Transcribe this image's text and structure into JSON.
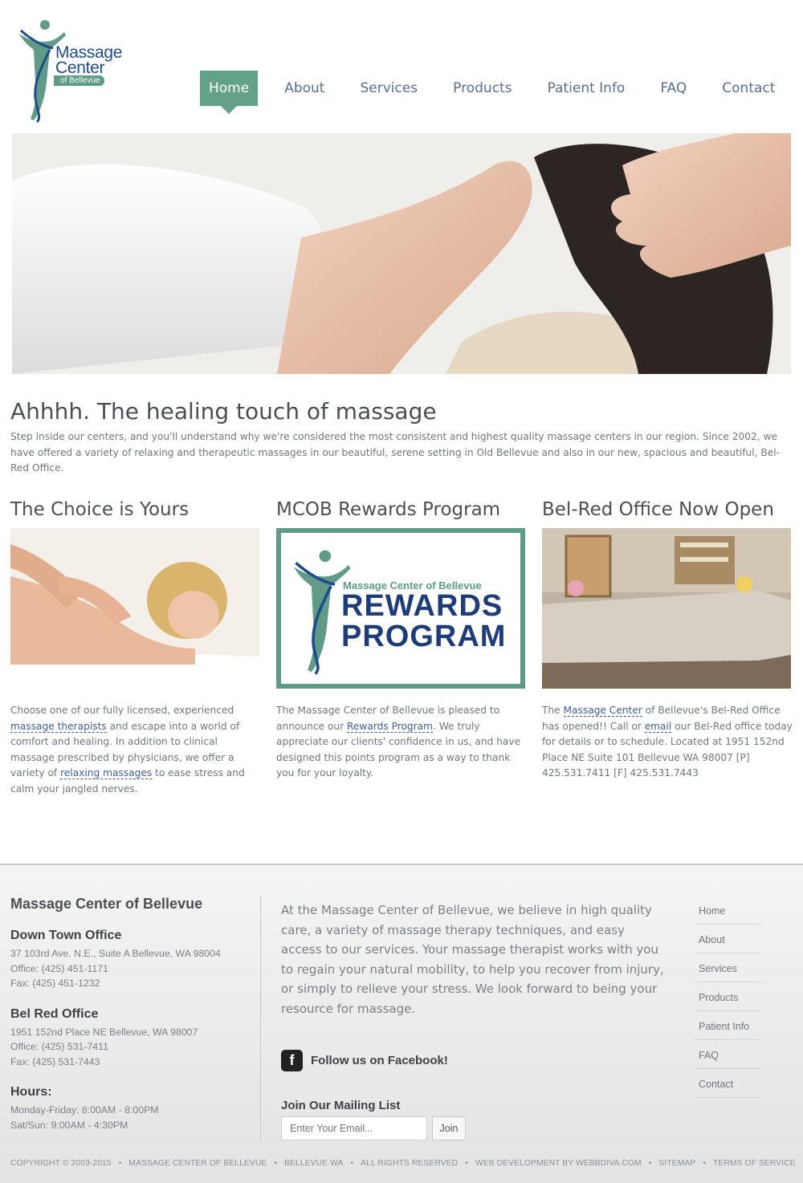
{
  "logo": {
    "line1": "Massage",
    "line2": "Center",
    "badge": "of Bellevue"
  },
  "nav": {
    "items": [
      "Home",
      "About",
      "Services",
      "Products",
      "Patient Info",
      "FAQ",
      "Contact"
    ],
    "active": "Home"
  },
  "intro": {
    "title": "Ahhhh. The healing touch of massage",
    "text": "Step inside our centers, and you'll understand why we're considered the most consistent and highest quality massage centers in our region. Since 2002, we have offered a variety of relaxing and therapeutic massages in our beautiful, serene setting in Old Bellevue and also in our new, spacious and beautiful, Bel-Red Office."
  },
  "columns": {
    "choice": {
      "title": "The Choice is Yours",
      "t1": "Choose one of our fully licensed, experienced ",
      "link1": "massage therapists",
      "t2": " and escape into a world of comfort and healing. In addition to clinical massage prescribed by physicians, we offer a variety of ",
      "link2": "relaxing massages",
      "t3": " to ease stress and calm your jangled nerves."
    },
    "rewards": {
      "title": "MCOB Rewards Program",
      "img_small": "Massage Center of Bellevue",
      "img_big1": "REWARDS",
      "img_big2": "PROGRAM",
      "t1": "The Massage Center of Bellevue is pleased to announce our ",
      "link1": "Rewards Program",
      "t2": ". We truly appreciate our clients' confidence in us, and have designed this points program as a way to thank you for your loyalty."
    },
    "belred": {
      "title": "Bel-Red Office Now Open",
      "t1": "The ",
      "link1": "Massage Center",
      "t2": " of Bellevue's Bel-Red Office has opened!! Call or ",
      "link2": "email",
      "t3": " our Bel-Red office today for details or to schedule. Located at 1951 152nd Place NE Suite 101 Bellevue WA 98007 [P] 425.531.7411 [F] 425.531.7443"
    }
  },
  "footer": {
    "title": "Massage Center of Bellevue",
    "downtown": {
      "heading": "Down Town Office",
      "address": "37 103rd Ave. N.E., Suite A Bellevue, WA   98004",
      "office": "Office: (425) 451-1171",
      "fax": "Fax: (425) 451-1232"
    },
    "belred": {
      "heading": "Bel Red Office",
      "address": "1951 152nd Place NE Bellevue, WA   98007",
      "office": "Office: (425) 531-7411",
      "fax": "Fax: (425) 531-7443"
    },
    "hours": {
      "heading": "Hours:",
      "weekdays": "Monday-Friday: 8:00AM - 8:00PM",
      "weekend": "Sat/Sun: 9:00AM - 4:30PM"
    },
    "about": "At the Massage Center of Bellevue, we believe in high quality care, a variety of massage therapy techniques, and easy access to our services. Your massage therapist works with you to regain your natural mobility, to help you recover from injury, or simply to relieve your stress. We look forward to being your resource for massage.",
    "facebook": {
      "icon": "f",
      "label": "Follow us on Facebook!"
    },
    "mailing": {
      "title": "Join Our Mailing List",
      "placeholder": "Enter Your Email...",
      "button": "Join"
    },
    "nav": [
      "Home",
      "About",
      "Services",
      "Products",
      "Patient Info",
      "FAQ",
      "Contact"
    ],
    "copyright": [
      "COPYRIGHT © 2003-2015",
      "MASSAGE CENTER OF BELLEVUE",
      "BELLEVUE WA",
      "ALL RIGHTS RESERVED",
      "WEB DEVELOPMENT BY WEBBDIVA.COM",
      "SITEMAP",
      "TERMS OF SERVICE"
    ],
    "separator": "•"
  },
  "colors": {
    "accent": "#63a289",
    "nav_text": "#5a6f8c",
    "logo_blue": "#1e4c8c",
    "link": "#3e5f95"
  }
}
